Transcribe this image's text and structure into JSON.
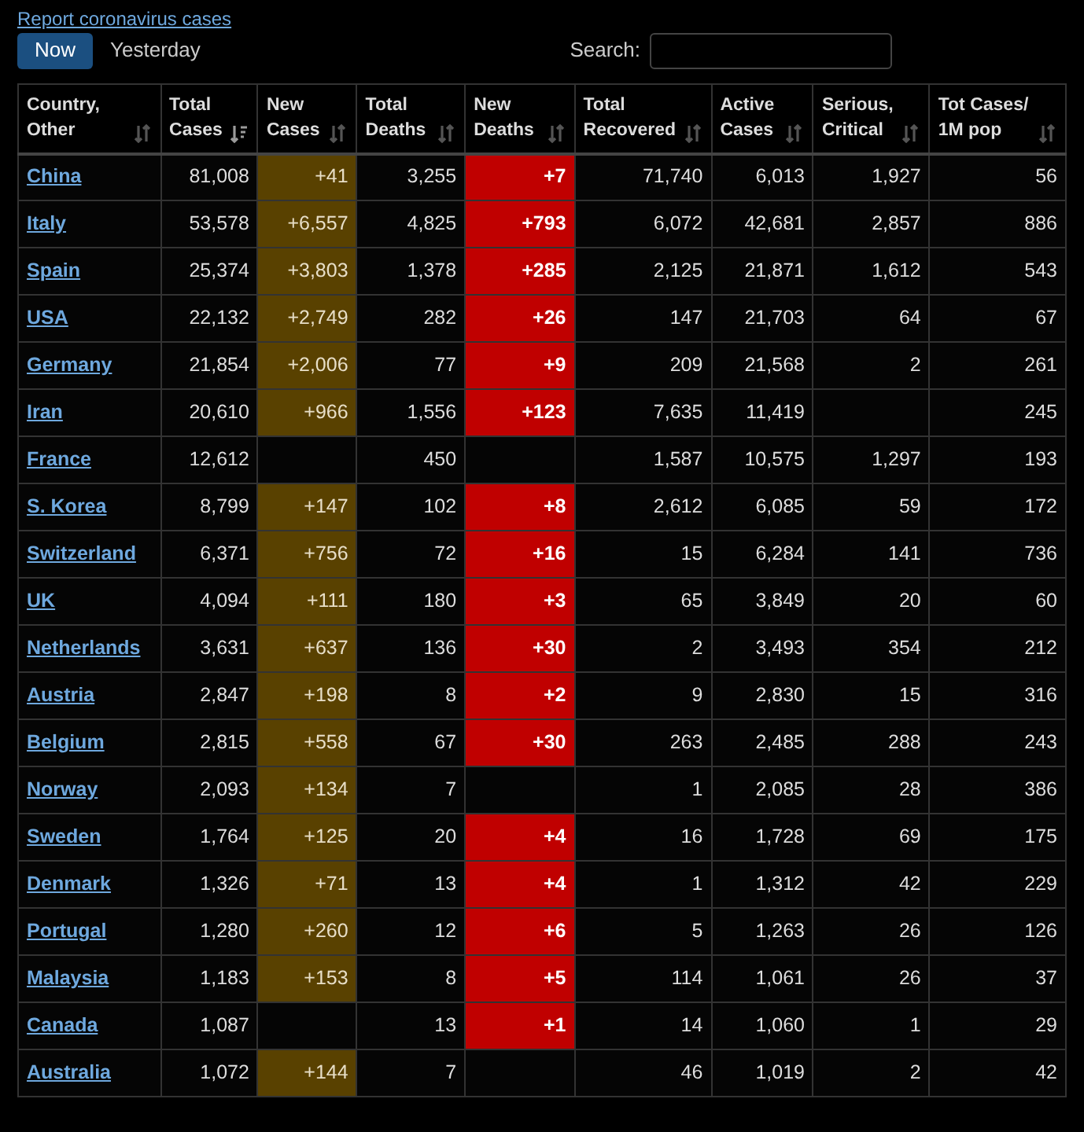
{
  "top_link": "Report coronavirus cases",
  "tabs": [
    {
      "label": "Now",
      "selected": true
    },
    {
      "label": "Yesterday",
      "selected": false
    }
  ],
  "search": {
    "label": "Search:"
  },
  "columns": [
    {
      "label": "Country, Other",
      "sorted": false
    },
    {
      "label": "Total Cases",
      "sorted": true
    },
    {
      "label": "New Cases",
      "sorted": false
    },
    {
      "label": "Total Deaths",
      "sorted": false
    },
    {
      "label": "New Deaths",
      "sorted": false
    },
    {
      "label": "Total Recovered",
      "sorted": false
    },
    {
      "label": "Active Cases",
      "sorted": false
    },
    {
      "label": "Serious, Critical",
      "sorted": false
    },
    {
      "label": "Tot Cases/ 1M pop",
      "sorted": false
    }
  ],
  "rows": [
    {
      "country": "China",
      "total_cases": "81,008",
      "new_cases": "+41",
      "total_deaths": "3,255",
      "new_deaths": "+7",
      "total_recovered": "71,740",
      "active_cases": "6,013",
      "serious": "1,927",
      "per_million": "56"
    },
    {
      "country": "Italy",
      "total_cases": "53,578",
      "new_cases": "+6,557",
      "total_deaths": "4,825",
      "new_deaths": "+793",
      "total_recovered": "6,072",
      "active_cases": "42,681",
      "serious": "2,857",
      "per_million": "886"
    },
    {
      "country": "Spain",
      "total_cases": "25,374",
      "new_cases": "+3,803",
      "total_deaths": "1,378",
      "new_deaths": "+285",
      "total_recovered": "2,125",
      "active_cases": "21,871",
      "serious": "1,612",
      "per_million": "543"
    },
    {
      "country": "USA",
      "total_cases": "22,132",
      "new_cases": "+2,749",
      "total_deaths": "282",
      "new_deaths": "+26",
      "total_recovered": "147",
      "active_cases": "21,703",
      "serious": "64",
      "per_million": "67"
    },
    {
      "country": "Germany",
      "total_cases": "21,854",
      "new_cases": "+2,006",
      "total_deaths": "77",
      "new_deaths": "+9",
      "total_recovered": "209",
      "active_cases": "21,568",
      "serious": "2",
      "per_million": "261"
    },
    {
      "country": "Iran",
      "total_cases": "20,610",
      "new_cases": "+966",
      "total_deaths": "1,556",
      "new_deaths": "+123",
      "total_recovered": "7,635",
      "active_cases": "11,419",
      "per_million": "245"
    },
    {
      "country": "France",
      "total_cases": "12,612",
      "total_deaths": "450",
      "total_recovered": "1,587",
      "active_cases": "10,575",
      "serious": "1,297",
      "per_million": "193"
    },
    {
      "country": "S. Korea",
      "total_cases": "8,799",
      "new_cases": "+147",
      "total_deaths": "102",
      "new_deaths": "+8",
      "total_recovered": "2,612",
      "active_cases": "6,085",
      "serious": "59",
      "per_million": "172"
    },
    {
      "country": "Switzerland",
      "total_cases": "6,371",
      "new_cases": "+756",
      "total_deaths": "72",
      "new_deaths": "+16",
      "total_recovered": "15",
      "active_cases": "6,284",
      "serious": "141",
      "per_million": "736"
    },
    {
      "country": "UK",
      "total_cases": "4,094",
      "new_cases": "+111",
      "total_deaths": "180",
      "new_deaths": "+3",
      "total_recovered": "65",
      "active_cases": "3,849",
      "serious": "20",
      "per_million": "60"
    },
    {
      "country": "Netherlands",
      "total_cases": "3,631",
      "new_cases": "+637",
      "total_deaths": "136",
      "new_deaths": "+30",
      "total_recovered": "2",
      "active_cases": "3,493",
      "serious": "354",
      "per_million": "212"
    },
    {
      "country": "Austria",
      "total_cases": "2,847",
      "new_cases": "+198",
      "total_deaths": "8",
      "new_deaths": "+2",
      "total_recovered": "9",
      "active_cases": "2,830",
      "serious": "15",
      "per_million": "316"
    },
    {
      "country": "Belgium",
      "total_cases": "2,815",
      "new_cases": "+558",
      "total_deaths": "67",
      "new_deaths": "+30",
      "total_recovered": "263",
      "active_cases": "2,485",
      "serious": "288",
      "per_million": "243"
    },
    {
      "country": "Norway",
      "total_cases": "2,093",
      "new_cases": "+134",
      "total_deaths": "7",
      "total_recovered": "1",
      "active_cases": "2,085",
      "serious": "28",
      "per_million": "386"
    },
    {
      "country": "Sweden",
      "total_cases": "1,764",
      "new_cases": "+125",
      "total_deaths": "20",
      "new_deaths": "+4",
      "total_recovered": "16",
      "active_cases": "1,728",
      "serious": "69",
      "per_million": "175"
    },
    {
      "country": "Denmark",
      "total_cases": "1,326",
      "new_cases": "+71",
      "total_deaths": "13",
      "new_deaths": "+4",
      "total_recovered": "1",
      "active_cases": "1,312",
      "serious": "42",
      "per_million": "229"
    },
    {
      "country": "Portugal",
      "total_cases": "1,280",
      "new_cases": "+260",
      "total_deaths": "12",
      "new_deaths": "+6",
      "total_recovered": "5",
      "active_cases": "1,263",
      "serious": "26",
      "per_million": "126"
    },
    {
      "country": "Malaysia",
      "total_cases": "1,183",
      "new_cases": "+153",
      "total_deaths": "8",
      "new_deaths": "+5",
      "total_recovered": "114",
      "active_cases": "1,061",
      "serious": "26",
      "per_million": "37"
    },
    {
      "country": "Canada",
      "total_cases": "1,087",
      "total_deaths": "13",
      "new_deaths": "+1",
      "total_recovered": "14",
      "active_cases": "1,060",
      "serious": "1",
      "per_million": "29"
    },
    {
      "country": "Australia",
      "total_cases": "1,072",
      "new_cases": "+144",
      "total_deaths": "7",
      "total_recovered": "46",
      "active_cases": "1,019",
      "serious": "2",
      "per_million": "42"
    }
  ]
}
